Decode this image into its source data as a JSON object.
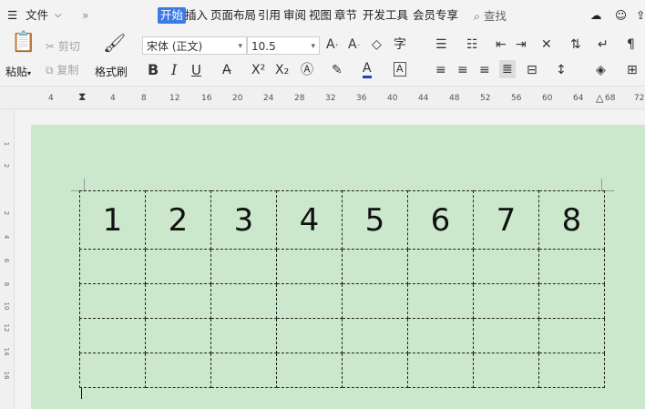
{
  "menubar": {
    "file_label": "文件",
    "tabs": [
      "开始",
      "插入",
      "页面布局",
      "引用",
      "审阅",
      "视图",
      "章节",
      "开发工具",
      "会员专享"
    ],
    "active_tab": "开始",
    "search_label": "查找"
  },
  "ribbon": {
    "paste_label": "粘贴",
    "cut_label": "剪切",
    "copy_label": "复制",
    "format_painter_label": "格式刷",
    "font_name": "宋体 (正文)",
    "font_size": "10.5",
    "bold": "B",
    "italic": "I",
    "underline": "U"
  },
  "ruler": {
    "ticks": [
      "4",
      "4",
      "8",
      "12",
      "16",
      "20",
      "24",
      "28",
      "32",
      "36",
      "40",
      "44",
      "48",
      "52",
      "56",
      "60",
      "64",
      "68",
      "72"
    ]
  },
  "vruler": {
    "ticks": [
      "1",
      "2",
      "2",
      "4",
      "6",
      "8",
      "10",
      "12",
      "14",
      "16"
    ]
  },
  "document": {
    "table_header": [
      "1",
      "2",
      "3",
      "4",
      "5",
      "6",
      "7",
      "8"
    ],
    "empty_rows": 4
  }
}
